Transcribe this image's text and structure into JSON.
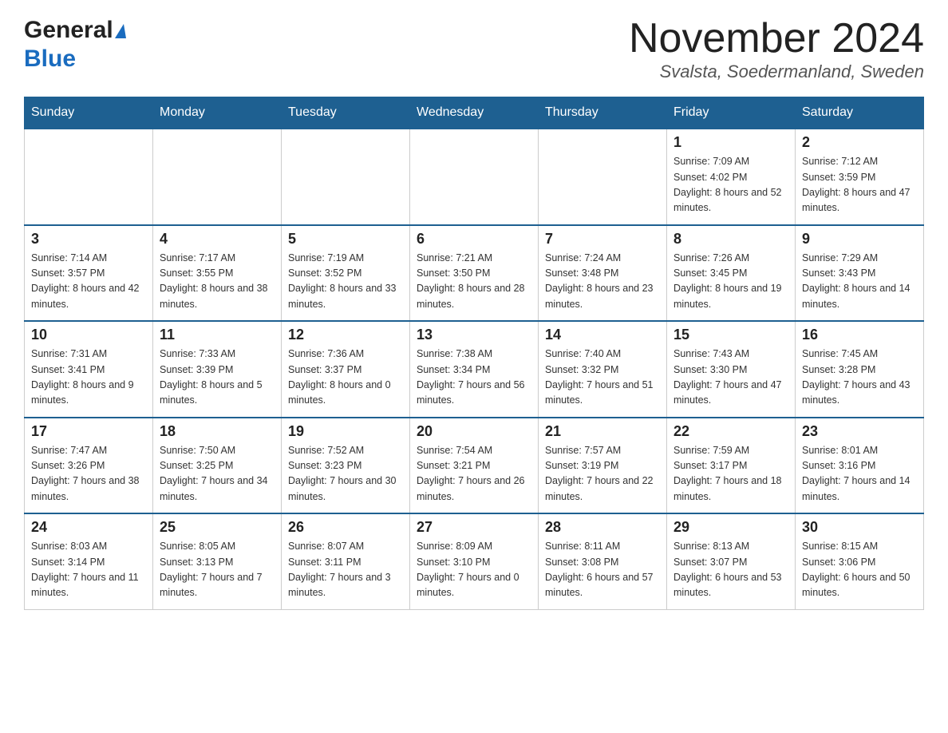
{
  "header": {
    "logo_general": "General",
    "logo_blue": "Blue",
    "month_title": "November 2024",
    "location": "Svalsta, Soedermanland, Sweden"
  },
  "weekdays": [
    "Sunday",
    "Monday",
    "Tuesday",
    "Wednesday",
    "Thursday",
    "Friday",
    "Saturday"
  ],
  "weeks": [
    {
      "days": [
        {
          "number": "",
          "sunrise": "",
          "sunset": "",
          "daylight": ""
        },
        {
          "number": "",
          "sunrise": "",
          "sunset": "",
          "daylight": ""
        },
        {
          "number": "",
          "sunrise": "",
          "sunset": "",
          "daylight": ""
        },
        {
          "number": "",
          "sunrise": "",
          "sunset": "",
          "daylight": ""
        },
        {
          "number": "",
          "sunrise": "",
          "sunset": "",
          "daylight": ""
        },
        {
          "number": "1",
          "sunrise": "Sunrise: 7:09 AM",
          "sunset": "Sunset: 4:02 PM",
          "daylight": "Daylight: 8 hours and 52 minutes."
        },
        {
          "number": "2",
          "sunrise": "Sunrise: 7:12 AM",
          "sunset": "Sunset: 3:59 PM",
          "daylight": "Daylight: 8 hours and 47 minutes."
        }
      ]
    },
    {
      "days": [
        {
          "number": "3",
          "sunrise": "Sunrise: 7:14 AM",
          "sunset": "Sunset: 3:57 PM",
          "daylight": "Daylight: 8 hours and 42 minutes."
        },
        {
          "number": "4",
          "sunrise": "Sunrise: 7:17 AM",
          "sunset": "Sunset: 3:55 PM",
          "daylight": "Daylight: 8 hours and 38 minutes."
        },
        {
          "number": "5",
          "sunrise": "Sunrise: 7:19 AM",
          "sunset": "Sunset: 3:52 PM",
          "daylight": "Daylight: 8 hours and 33 minutes."
        },
        {
          "number": "6",
          "sunrise": "Sunrise: 7:21 AM",
          "sunset": "Sunset: 3:50 PM",
          "daylight": "Daylight: 8 hours and 28 minutes."
        },
        {
          "number": "7",
          "sunrise": "Sunrise: 7:24 AM",
          "sunset": "Sunset: 3:48 PM",
          "daylight": "Daylight: 8 hours and 23 minutes."
        },
        {
          "number": "8",
          "sunrise": "Sunrise: 7:26 AM",
          "sunset": "Sunset: 3:45 PM",
          "daylight": "Daylight: 8 hours and 19 minutes."
        },
        {
          "number": "9",
          "sunrise": "Sunrise: 7:29 AM",
          "sunset": "Sunset: 3:43 PM",
          "daylight": "Daylight: 8 hours and 14 minutes."
        }
      ]
    },
    {
      "days": [
        {
          "number": "10",
          "sunrise": "Sunrise: 7:31 AM",
          "sunset": "Sunset: 3:41 PM",
          "daylight": "Daylight: 8 hours and 9 minutes."
        },
        {
          "number": "11",
          "sunrise": "Sunrise: 7:33 AM",
          "sunset": "Sunset: 3:39 PM",
          "daylight": "Daylight: 8 hours and 5 minutes."
        },
        {
          "number": "12",
          "sunrise": "Sunrise: 7:36 AM",
          "sunset": "Sunset: 3:37 PM",
          "daylight": "Daylight: 8 hours and 0 minutes."
        },
        {
          "number": "13",
          "sunrise": "Sunrise: 7:38 AM",
          "sunset": "Sunset: 3:34 PM",
          "daylight": "Daylight: 7 hours and 56 minutes."
        },
        {
          "number": "14",
          "sunrise": "Sunrise: 7:40 AM",
          "sunset": "Sunset: 3:32 PM",
          "daylight": "Daylight: 7 hours and 51 minutes."
        },
        {
          "number": "15",
          "sunrise": "Sunrise: 7:43 AM",
          "sunset": "Sunset: 3:30 PM",
          "daylight": "Daylight: 7 hours and 47 minutes."
        },
        {
          "number": "16",
          "sunrise": "Sunrise: 7:45 AM",
          "sunset": "Sunset: 3:28 PM",
          "daylight": "Daylight: 7 hours and 43 minutes."
        }
      ]
    },
    {
      "days": [
        {
          "number": "17",
          "sunrise": "Sunrise: 7:47 AM",
          "sunset": "Sunset: 3:26 PM",
          "daylight": "Daylight: 7 hours and 38 minutes."
        },
        {
          "number": "18",
          "sunrise": "Sunrise: 7:50 AM",
          "sunset": "Sunset: 3:25 PM",
          "daylight": "Daylight: 7 hours and 34 minutes."
        },
        {
          "number": "19",
          "sunrise": "Sunrise: 7:52 AM",
          "sunset": "Sunset: 3:23 PM",
          "daylight": "Daylight: 7 hours and 30 minutes."
        },
        {
          "number": "20",
          "sunrise": "Sunrise: 7:54 AM",
          "sunset": "Sunset: 3:21 PM",
          "daylight": "Daylight: 7 hours and 26 minutes."
        },
        {
          "number": "21",
          "sunrise": "Sunrise: 7:57 AM",
          "sunset": "Sunset: 3:19 PM",
          "daylight": "Daylight: 7 hours and 22 minutes."
        },
        {
          "number": "22",
          "sunrise": "Sunrise: 7:59 AM",
          "sunset": "Sunset: 3:17 PM",
          "daylight": "Daylight: 7 hours and 18 minutes."
        },
        {
          "number": "23",
          "sunrise": "Sunrise: 8:01 AM",
          "sunset": "Sunset: 3:16 PM",
          "daylight": "Daylight: 7 hours and 14 minutes."
        }
      ]
    },
    {
      "days": [
        {
          "number": "24",
          "sunrise": "Sunrise: 8:03 AM",
          "sunset": "Sunset: 3:14 PM",
          "daylight": "Daylight: 7 hours and 11 minutes."
        },
        {
          "number": "25",
          "sunrise": "Sunrise: 8:05 AM",
          "sunset": "Sunset: 3:13 PM",
          "daylight": "Daylight: 7 hours and 7 minutes."
        },
        {
          "number": "26",
          "sunrise": "Sunrise: 8:07 AM",
          "sunset": "Sunset: 3:11 PM",
          "daylight": "Daylight: 7 hours and 3 minutes."
        },
        {
          "number": "27",
          "sunrise": "Sunrise: 8:09 AM",
          "sunset": "Sunset: 3:10 PM",
          "daylight": "Daylight: 7 hours and 0 minutes."
        },
        {
          "number": "28",
          "sunrise": "Sunrise: 8:11 AM",
          "sunset": "Sunset: 3:08 PM",
          "daylight": "Daylight: 6 hours and 57 minutes."
        },
        {
          "number": "29",
          "sunrise": "Sunrise: 8:13 AM",
          "sunset": "Sunset: 3:07 PM",
          "daylight": "Daylight: 6 hours and 53 minutes."
        },
        {
          "number": "30",
          "sunrise": "Sunrise: 8:15 AM",
          "sunset": "Sunset: 3:06 PM",
          "daylight": "Daylight: 6 hours and 50 minutes."
        }
      ]
    }
  ]
}
